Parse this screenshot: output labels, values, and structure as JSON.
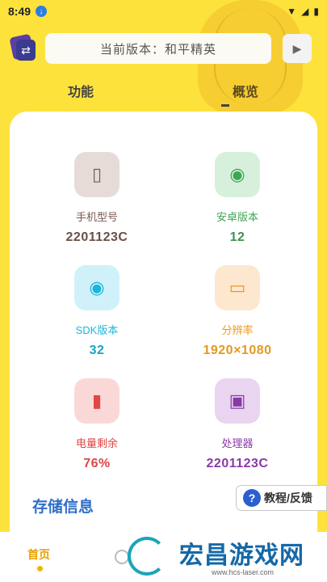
{
  "status_bar": {
    "time": "8:49"
  },
  "header": {
    "version_text": "当前版本：和平精英"
  },
  "tabs": [
    {
      "label": "功能"
    },
    {
      "label": "概览"
    }
  ],
  "info_items": [
    {
      "label": "手机型号",
      "value": "2201123C",
      "icon": "phone-icon",
      "bg": "#e5dcd8",
      "fg": "#7a5a52",
      "value_color": "#6b4f47"
    },
    {
      "label": "安卓版本",
      "value": "12",
      "icon": "android-icon",
      "bg": "#d7f0dc",
      "fg": "#3ea552",
      "value_color": "#3f9150"
    },
    {
      "label": "SDK版本",
      "value": "32",
      "icon": "android-icon",
      "bg": "#d0f1fa",
      "fg": "#1ab5d8",
      "value_color": "#1aa3c3"
    },
    {
      "label": "分辨率",
      "value": "1920×1080",
      "icon": "screen-icon",
      "bg": "#fde7cf",
      "fg": "#ee9a1c",
      "value_color": "#e19a23"
    },
    {
      "label": "电量剩余",
      "value": "76%",
      "icon": "battery-icon",
      "bg": "#fbd8d8",
      "fg": "#e14545",
      "value_color": "#d94848"
    },
    {
      "label": "处理器",
      "value": "2201123C",
      "icon": "chip-icon",
      "bg": "#ead5f0",
      "fg": "#8a3aa6",
      "value_color": "#8a3aa6"
    }
  ],
  "storage": {
    "title": "存储信息"
  },
  "help_button": {
    "label": "教程/反馈"
  },
  "bottom_nav": {
    "home_label": "首页"
  },
  "watermark": {
    "main": "宏昌游戏网",
    "sub": "www.hcs-laser.com"
  }
}
